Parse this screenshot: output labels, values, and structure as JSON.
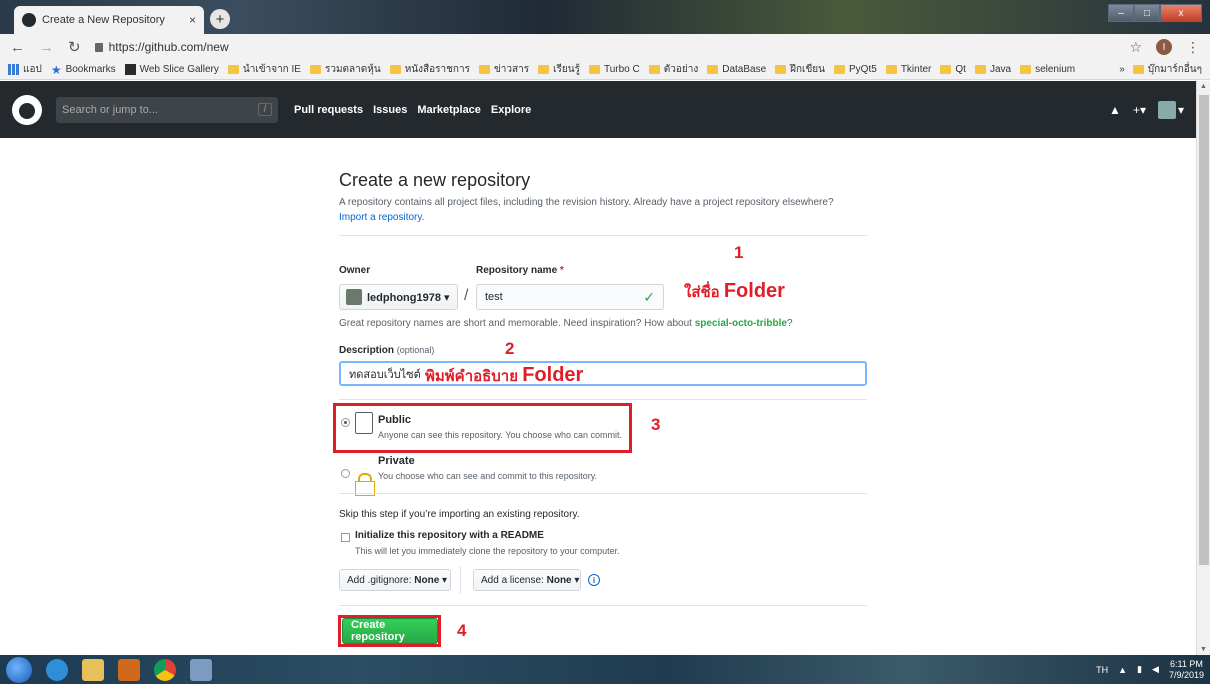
{
  "browser": {
    "tab_title": "Create a New Repository",
    "tab_close": "×",
    "new_tab": "+",
    "url": "https://github.com/new",
    "profile_initial": "I",
    "window_buttons": [
      "–",
      "□",
      "x"
    ]
  },
  "bookmarks": {
    "apps_label": "แอป",
    "items": [
      "Bookmarks",
      "Web Slice Gallery",
      "นำเข้าจาก IE",
      "รวมตลาดหุ้น",
      "หนังสือราชการ",
      "ข่าวสาร",
      "เรียนรู้",
      "Turbo C",
      "ตัวอย่าง",
      "DataBase",
      "ฝึกเขียน",
      "PyQt5",
      "Tkinter",
      "Qt",
      "Java",
      "selenium"
    ],
    "more": "»",
    "other": "บุ๊กมาร์กอื่นๆ"
  },
  "github_header": {
    "search_placeholder": "Search or jump to...",
    "search_shortcut": "/",
    "nav": [
      "Pull requests",
      "Issues",
      "Marketplace",
      "Explore"
    ],
    "bell": "🔔",
    "plus": "+▾",
    "avatar_caret": "▾"
  },
  "form": {
    "title": "Create a new repository",
    "subtitle": "A repository contains all project files, including the revision history. Already have a project repository elsewhere?",
    "import_link": "Import a repository.",
    "owner_label": "Owner",
    "repo_name_label": "Repository name",
    "required_mark": "*",
    "owner_value": "ledphong1978 ▾",
    "slash": "/",
    "repo_name_value": "test",
    "check": "✓",
    "name_hint_prefix": "Great repository names are short and memorable. Need inspiration? How about",
    "name_hint_suggestion": "special-octo-tribble",
    "name_hint_suffix": "?",
    "description_label": "Description",
    "description_optional": "(optional)",
    "description_value": "ทดสอบเว็บไซต์",
    "public_title": "Public",
    "public_desc": "Anyone can see this repository. You choose who can commit.",
    "private_title": "Private",
    "private_desc": "You choose who can see and commit to this repository.",
    "skip_text": "Skip this step if you’re importing an existing repository.",
    "init_title": "Initialize this repository with a README",
    "init_desc": "This will let you immediately clone the repository to your computer.",
    "gitignore_label": "Add .gitignore:",
    "gitignore_value": "None ▾",
    "license_label": "Add a license:",
    "license_value": "None ▾",
    "info": "i",
    "create_button": "Create repository"
  },
  "annotations": {
    "n1": "1",
    "n2": "2",
    "n3": "3",
    "n4": "4",
    "folder_name_thai": "ใส่ชื่อ",
    "folder_desc_thai": "พิมพ์คำอธิบาย",
    "folder_word": "Folder",
    "color": "#e01e2a"
  },
  "taskbar": {
    "lang": "TH",
    "tray_arrow": "▲",
    "time": "6:11 PM",
    "date": "7/9/2019"
  }
}
